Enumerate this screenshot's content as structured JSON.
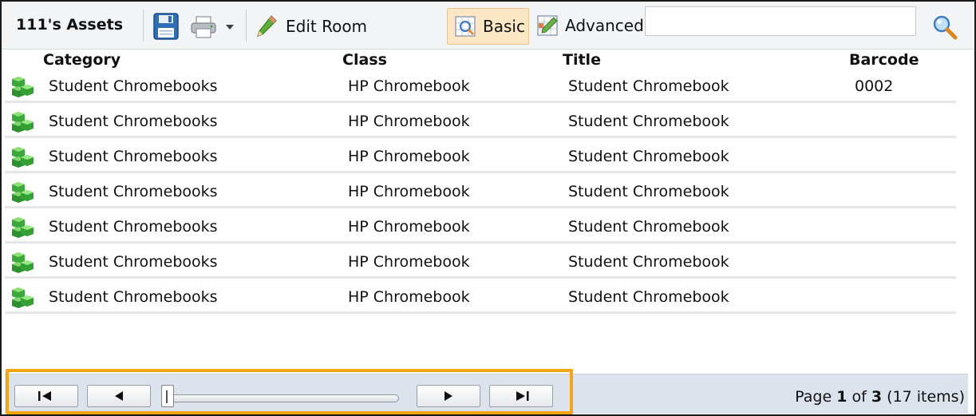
{
  "toolbar": {
    "title": "111's Assets",
    "save_icon": "floppy-disk-icon",
    "print_icon": "printer-icon",
    "edit_room_label": "Edit Room",
    "basic_label": "Basic",
    "advanced_label": "Advanced",
    "search_value": "",
    "search_placeholder": "",
    "accent_color": "#fbe7c6"
  },
  "table": {
    "columns": [
      "Category",
      "Class",
      "Title",
      "Barcode"
    ],
    "rows": [
      {
        "category": "Student Chromebooks",
        "class": "HP Chromebook",
        "title": "Student Chromebook",
        "barcode": "0002"
      },
      {
        "category": "Student Chromebooks",
        "class": "HP Chromebook",
        "title": "Student Chromebook",
        "barcode": ""
      },
      {
        "category": "Student Chromebooks",
        "class": "HP Chromebook",
        "title": "Student Chromebook",
        "barcode": ""
      },
      {
        "category": "Student Chromebooks",
        "class": "HP Chromebook",
        "title": "Student Chromebook",
        "barcode": ""
      },
      {
        "category": "Student Chromebooks",
        "class": "HP Chromebook",
        "title": "Student Chromebook",
        "barcode": ""
      },
      {
        "category": "Student Chromebooks",
        "class": "HP Chromebook",
        "title": "Student Chromebook",
        "barcode": ""
      },
      {
        "category": "Student Chromebooks",
        "class": "HP Chromebook",
        "title": "Student Chromebook",
        "barcode": ""
      }
    ]
  },
  "pager": {
    "page_prefix": "Page",
    "current_page": "1",
    "of_label": "of",
    "total_pages": "3",
    "items_text": "(17 items)",
    "highlight_color": "#f5a50f"
  }
}
